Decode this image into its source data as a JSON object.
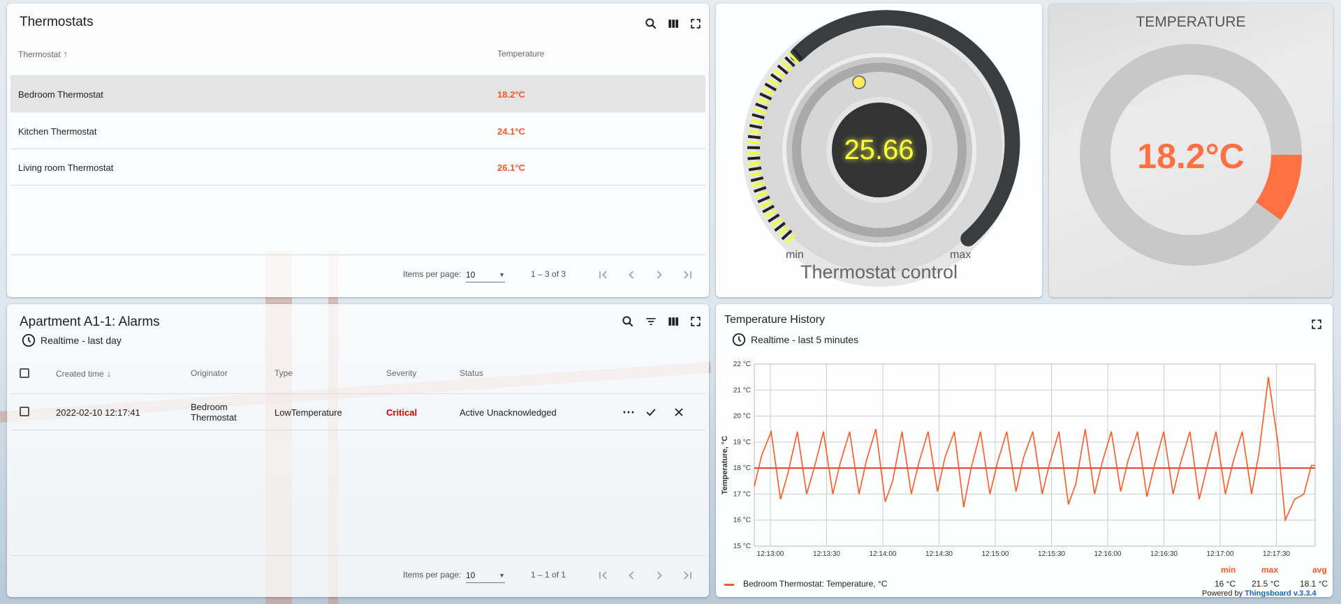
{
  "thermostats": {
    "title": "Thermostats",
    "columns": [
      "Thermostat",
      "Temperature"
    ],
    "rows": [
      {
        "name": "Bedroom Thermostat",
        "temp": "18.2°C"
      },
      {
        "name": "Kitchen Thermostat",
        "temp": "24.1°C"
      },
      {
        "name": "Living room Thermostat",
        "temp": "26.1°C"
      }
    ],
    "items_per_page_label": "Items per page:",
    "items_per_page": "10",
    "range": "1 – 3 of 3"
  },
  "control": {
    "value": "25.66",
    "min_label": "min",
    "max_label": "max",
    "title": "Thermostat control",
    "fill_fraction": 0.35
  },
  "temperature": {
    "title": "TEMPERATURE",
    "value": "18.2°C",
    "fill_fraction": 0.1
  },
  "alarms": {
    "title": "Apartment A1-1: Alarms",
    "timewindow": "Realtime - last day",
    "columns": [
      "Created time",
      "Originator",
      "Type",
      "Severity",
      "Status"
    ],
    "rows": [
      {
        "time": "2022-02-10 12:17:41",
        "originator": "Bedroom Thermostat",
        "type": "LowTemperature",
        "severity": "Critical",
        "status": "Active Unacknowledged"
      }
    ],
    "items_per_page_label": "Items per page:",
    "items_per_page": "10",
    "range": "1 – 1 of 1"
  },
  "history": {
    "title": "Temperature History",
    "timewindow": "Realtime - last 5 minutes",
    "legend_headers": [
      "min",
      "max",
      "avg"
    ],
    "legend_series": "Bedroom Thermostat: Temperature, °C",
    "legend_values": [
      "16 °C",
      "21.5 °C",
      "18.1 °C"
    ],
    "powered_by": "Powered by",
    "powered_link": "Thingsboard v.3.3.4",
    "colors": {
      "series": "#ff5722",
      "threshold": "#e53935"
    }
  },
  "chart_data": {
    "type": "line",
    "ylabel": "Temperature, °C",
    "yticks": [
      "15 °C",
      "16 °C",
      "17 °C",
      "18 °C",
      "19 °C",
      "20 °C",
      "21 °C",
      "22 °C"
    ],
    "xticks": [
      "12:13:00",
      "12:13:30",
      "12:14:00",
      "12:14:30",
      "12:15:00",
      "12:15:30",
      "12:16:00",
      "12:16:30",
      "12:17:00",
      "12:17:30"
    ],
    "ylim": [
      15,
      22
    ],
    "threshold": 18,
    "series": [
      {
        "name": "Bedroom Thermostat: Temperature, °C",
        "x": [
          0,
          4,
          9,
          14,
          18,
          23,
          28,
          32,
          37,
          42,
          46,
          51,
          56,
          60,
          65,
          70,
          74,
          79,
          84,
          88,
          93,
          98,
          102,
          107,
          112,
          116,
          121,
          126,
          130,
          135,
          140,
          144,
          149,
          154,
          158,
          163,
          168,
          172,
          177,
          182,
          186,
          191,
          196,
          200,
          205,
          210,
          214,
          219,
          224,
          228,
          233,
          238,
          242,
          247,
          252,
          256,
          261,
          266,
          270,
          275,
          280,
          284,
          289,
          294,
          298,
          300
        ],
        "y": [
          17.3,
          18.5,
          19.4,
          16.8,
          17.8,
          19.4,
          17.0,
          18.0,
          19.4,
          17.0,
          18.2,
          19.4,
          17.0,
          18.3,
          19.5,
          16.7,
          17.5,
          19.4,
          17.0,
          18.2,
          19.4,
          17.1,
          18.4,
          19.4,
          16.5,
          18.0,
          19.4,
          17.0,
          18.2,
          19.4,
          17.1,
          18.4,
          19.4,
          17.0,
          18.2,
          19.4,
          16.6,
          17.4,
          19.5,
          17.0,
          18.2,
          19.4,
          17.1,
          18.3,
          19.4,
          16.9,
          18.1,
          19.4,
          17.0,
          18.2,
          19.4,
          16.8,
          18.0,
          19.4,
          17.0,
          18.2,
          19.4,
          17.0,
          18.6,
          21.5,
          19.0,
          16.0,
          16.8,
          17.0,
          18.1,
          18.1
        ]
      }
    ]
  }
}
